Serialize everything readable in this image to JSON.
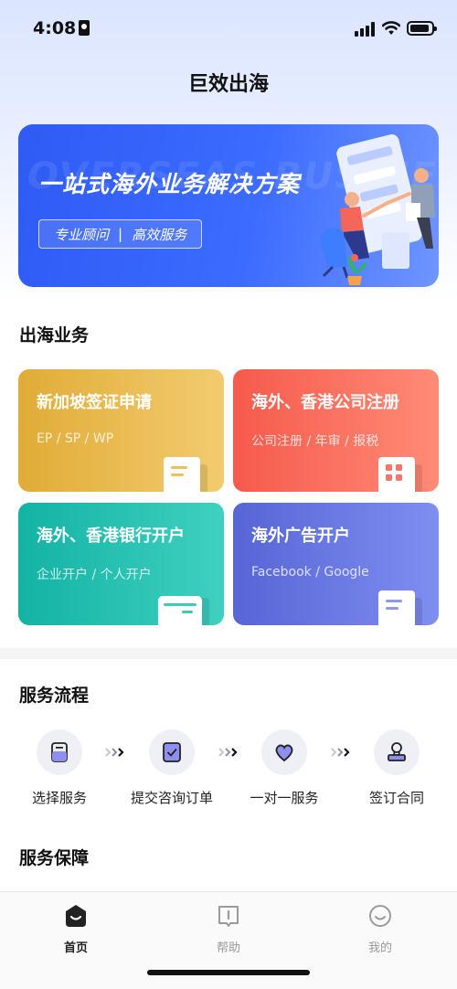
{
  "status_bar": {
    "time": "4:08"
  },
  "nav": {
    "title": "巨效出海"
  },
  "banner": {
    "bg_text": "OVERSEAS BUSINESS",
    "title": "一站式海外业务解决方案",
    "tag_1": "专业顾问",
    "tag_sep": "|",
    "tag_2": "高效服务"
  },
  "business_section": {
    "title": "出海业务"
  },
  "cards": [
    {
      "title": "新加坡签证申请",
      "subtitle": "EP / SP / WP",
      "color": "#e0ac36"
    },
    {
      "title": "海外、香港公司注册",
      "subtitle": "公司注册 / 年审 / 报税",
      "color": "#f65a4c"
    },
    {
      "title": "海外、香港银行开户",
      "subtitle": "企业开户 / 个人开户",
      "color": "#13b3a4"
    },
    {
      "title": "海外广告开户",
      "subtitle": "Facebook / Google",
      "color": "#5765d6"
    }
  ],
  "process_section": {
    "title": "服务流程",
    "steps": [
      {
        "label": "选择服务",
        "icon": "document-icon"
      },
      {
        "label": "提交咨询订单",
        "icon": "checklist-icon"
      },
      {
        "label": "一对一服务",
        "icon": "heart-icon"
      },
      {
        "label": "签订合同",
        "icon": "stamp-icon"
      }
    ]
  },
  "guarantee_section": {
    "title": "服务保障"
  },
  "tabbar": {
    "tabs": [
      {
        "label": "首页",
        "icon": "home-icon",
        "active": true
      },
      {
        "label": "帮助",
        "icon": "help-book-icon",
        "active": false
      },
      {
        "label": "我的",
        "icon": "profile-smile-icon",
        "active": false
      }
    ]
  },
  "colors": {
    "accent": "#2f5bf5",
    "icon_purple": "#5b5fc7"
  }
}
